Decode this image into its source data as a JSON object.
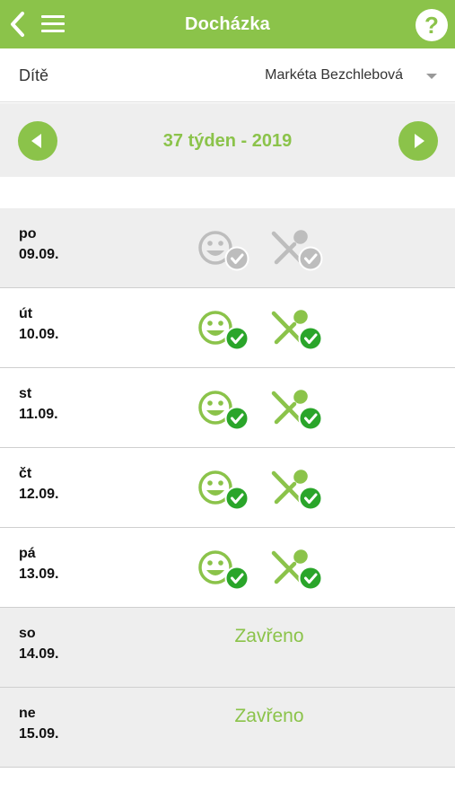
{
  "header": {
    "title": "Docházka",
    "help_label": "?"
  },
  "child": {
    "label": "Dítě",
    "selected": "Markéta Bezchlebová"
  },
  "week": {
    "label": "37 týden - 2019"
  },
  "colors": {
    "accent": "#8bc34a",
    "check_green": "#2aa52a",
    "inactive": "#bdbdbd"
  },
  "days": [
    {
      "name": "po",
      "date": "09.09.",
      "status": "inactive"
    },
    {
      "name": "út",
      "date": "10.09.",
      "status": "present"
    },
    {
      "name": "st",
      "date": "11.09.",
      "status": "present"
    },
    {
      "name": "čt",
      "date": "12.09.",
      "status": "present"
    },
    {
      "name": "pá",
      "date": "13.09.",
      "status": "present"
    },
    {
      "name": "so",
      "date": "14.09.",
      "status": "closed",
      "closed_label": "Zavřeno"
    },
    {
      "name": "ne",
      "date": "15.09.",
      "status": "closed",
      "closed_label": "Zavřeno"
    }
  ]
}
